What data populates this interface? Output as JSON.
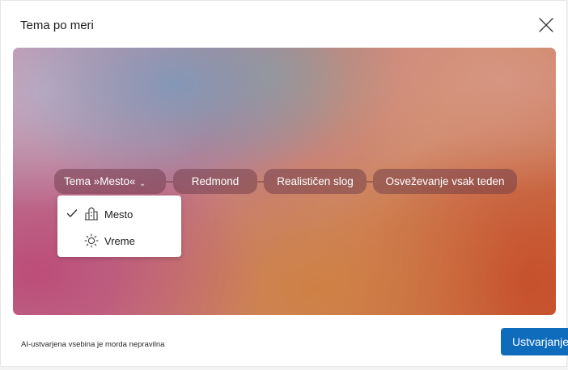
{
  "dialog": {
    "title": "Tema po meri",
    "close_icon": "close-icon"
  },
  "preview": {
    "chips": [
      {
        "label": "Tema »Mesto«",
        "has_dropdown": true
      },
      {
        "label": "Redmond"
      },
      {
        "label": "Realističen slog"
      },
      {
        "label": "Osveževanje vsak teden"
      }
    ],
    "dropdown": {
      "items": [
        {
          "label": "Mesto",
          "icon": "city-icon",
          "selected": true
        },
        {
          "label": "Vreme",
          "icon": "sun-icon",
          "selected": false
        }
      ]
    }
  },
  "footer": {
    "disclaimer": "AI-ustvarjena vsebina je morda nepravilna",
    "create_label": "Ustvarjanje"
  },
  "colors": {
    "accent": "#0f6cbd",
    "chip_bg": "#6e3a48"
  }
}
